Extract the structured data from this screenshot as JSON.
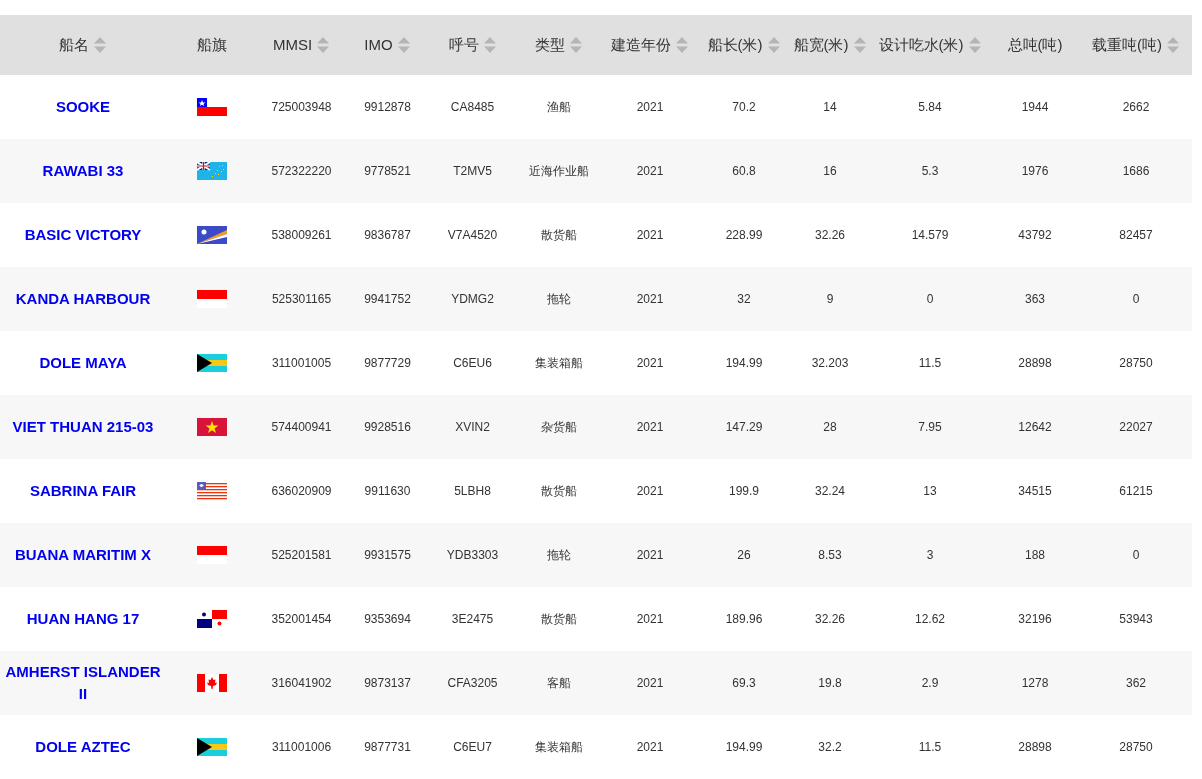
{
  "table": {
    "columns": [
      {
        "label": "船名",
        "sortable": true
      },
      {
        "label": "船旗",
        "sortable": false
      },
      {
        "label": "MMSI",
        "sortable": true
      },
      {
        "label": "IMO",
        "sortable": true
      },
      {
        "label": "呼号",
        "sortable": true
      },
      {
        "label": "类型",
        "sortable": true
      },
      {
        "label": "建造年份",
        "sortable": true
      },
      {
        "label": "船长(米)",
        "sortable": true
      },
      {
        "label": "船宽(米)",
        "sortable": true
      },
      {
        "label": "设计吃水(米)",
        "sortable": true
      },
      {
        "label": "总吨(吨)",
        "sortable": false
      },
      {
        "label": "载重吨(吨)",
        "sortable": true
      }
    ],
    "rows": [
      {
        "cells": [
          {
            "kind": "link",
            "text": "SOOKE"
          },
          {
            "kind": "chile"
          },
          {
            "kind": "text",
            "text": "725003948"
          },
          {
            "kind": "text",
            "text": "9912878"
          },
          {
            "kind": "text",
            "text": "CA8485"
          },
          {
            "kind": "text",
            "text": "渔船"
          },
          {
            "kind": "text",
            "text": "2021"
          },
          {
            "kind": "text",
            "text": "70.2"
          },
          {
            "kind": "text",
            "text": "14"
          },
          {
            "kind": "text",
            "text": "5.84"
          },
          {
            "kind": "text",
            "text": "1944"
          },
          {
            "kind": "text",
            "text": "2662"
          }
        ]
      },
      {
        "cells": [
          {
            "kind": "link",
            "text": "RAWABI 33"
          },
          {
            "kind": "tuvalu"
          },
          {
            "kind": "text",
            "text": "572322220"
          },
          {
            "kind": "text",
            "text": "9778521"
          },
          {
            "kind": "text",
            "text": "T2MV5"
          },
          {
            "kind": "text",
            "text": "近海作业船"
          },
          {
            "kind": "text",
            "text": "2021"
          },
          {
            "kind": "text",
            "text": "60.8"
          },
          {
            "kind": "text",
            "text": "16"
          },
          {
            "kind": "text",
            "text": "5.3"
          },
          {
            "kind": "text",
            "text": "1976"
          },
          {
            "kind": "text",
            "text": "1686"
          }
        ]
      },
      {
        "cells": [
          {
            "kind": "link",
            "text": "BASIC VICTORY"
          },
          {
            "kind": "marshall"
          },
          {
            "kind": "text",
            "text": "538009261"
          },
          {
            "kind": "text",
            "text": "9836787"
          },
          {
            "kind": "text",
            "text": "V7A4520"
          },
          {
            "kind": "text",
            "text": "散货船"
          },
          {
            "kind": "text",
            "text": "2021"
          },
          {
            "kind": "text",
            "text": "228.99"
          },
          {
            "kind": "text",
            "text": "32.26"
          },
          {
            "kind": "text",
            "text": "14.579"
          },
          {
            "kind": "text",
            "text": "43792"
          },
          {
            "kind": "text",
            "text": "82457"
          }
        ]
      },
      {
        "cells": [
          {
            "kind": "link",
            "text": "KANDA HARBOUR"
          },
          {
            "kind": "indonesia"
          },
          {
            "kind": "text",
            "text": "525301165"
          },
          {
            "kind": "text",
            "text": "9941752"
          },
          {
            "kind": "text",
            "text": "YDMG2"
          },
          {
            "kind": "text",
            "text": "拖轮"
          },
          {
            "kind": "text",
            "text": "2021"
          },
          {
            "kind": "text",
            "text": "32"
          },
          {
            "kind": "text",
            "text": "9"
          },
          {
            "kind": "text",
            "text": "0"
          },
          {
            "kind": "text",
            "text": "363"
          },
          {
            "kind": "text",
            "text": "0"
          }
        ]
      },
      {
        "cells": [
          {
            "kind": "link",
            "text": "DOLE MAYA"
          },
          {
            "kind": "bahamas"
          },
          {
            "kind": "text",
            "text": "311001005"
          },
          {
            "kind": "text",
            "text": "9877729"
          },
          {
            "kind": "text",
            "text": "C6EU6"
          },
          {
            "kind": "text",
            "text": "集装箱船"
          },
          {
            "kind": "text",
            "text": "2021"
          },
          {
            "kind": "text",
            "text": "194.99"
          },
          {
            "kind": "text",
            "text": "32.203"
          },
          {
            "kind": "text",
            "text": "11.5"
          },
          {
            "kind": "text",
            "text": "28898"
          },
          {
            "kind": "text",
            "text": "28750"
          }
        ]
      },
      {
        "cells": [
          {
            "kind": "link",
            "text": "VIET THUAN 215-03"
          },
          {
            "kind": "vietnam"
          },
          {
            "kind": "text",
            "text": "574400941"
          },
          {
            "kind": "text",
            "text": "9928516"
          },
          {
            "kind": "text",
            "text": "XVIN2"
          },
          {
            "kind": "text",
            "text": "杂货船"
          },
          {
            "kind": "text",
            "text": "2021"
          },
          {
            "kind": "text",
            "text": "147.29"
          },
          {
            "kind": "text",
            "text": "28"
          },
          {
            "kind": "text",
            "text": "7.95"
          },
          {
            "kind": "text",
            "text": "12642"
          },
          {
            "kind": "text",
            "text": "22027"
          }
        ]
      },
      {
        "cells": [
          {
            "kind": "link",
            "text": "SABRINA FAIR"
          },
          {
            "kind": "liberia"
          },
          {
            "kind": "text",
            "text": "636020909"
          },
          {
            "kind": "text",
            "text": "9911630"
          },
          {
            "kind": "text",
            "text": "5LBH8"
          },
          {
            "kind": "text",
            "text": "散货船"
          },
          {
            "kind": "text",
            "text": "2021"
          },
          {
            "kind": "text",
            "text": "199.9"
          },
          {
            "kind": "text",
            "text": "32.24"
          },
          {
            "kind": "text",
            "text": "13"
          },
          {
            "kind": "text",
            "text": "34515"
          },
          {
            "kind": "text",
            "text": "61215"
          }
        ]
      },
      {
        "cells": [
          {
            "kind": "link",
            "text": "BUANA MARITIM X"
          },
          {
            "kind": "indonesia"
          },
          {
            "kind": "text",
            "text": "525201581"
          },
          {
            "kind": "text",
            "text": "9931575"
          },
          {
            "kind": "text",
            "text": "YDB3303"
          },
          {
            "kind": "text",
            "text": "拖轮"
          },
          {
            "kind": "text",
            "text": "2021"
          },
          {
            "kind": "text",
            "text": "26"
          },
          {
            "kind": "text",
            "text": "8.53"
          },
          {
            "kind": "text",
            "text": "3"
          },
          {
            "kind": "text",
            "text": "188"
          },
          {
            "kind": "text",
            "text": "0"
          }
        ]
      },
      {
        "cells": [
          {
            "kind": "link",
            "text": "HUAN HANG 17"
          },
          {
            "kind": "panama"
          },
          {
            "kind": "text",
            "text": "352001454"
          },
          {
            "kind": "text",
            "text": "9353694"
          },
          {
            "kind": "text",
            "text": "3E2475"
          },
          {
            "kind": "text",
            "text": "散货船"
          },
          {
            "kind": "text",
            "text": "2021"
          },
          {
            "kind": "text",
            "text": "189.96"
          },
          {
            "kind": "text",
            "text": "32.26"
          },
          {
            "kind": "text",
            "text": "12.62"
          },
          {
            "kind": "text",
            "text": "32196"
          },
          {
            "kind": "text",
            "text": "53943"
          }
        ]
      },
      {
        "cells": [
          {
            "kind": "link",
            "text": "AMHERST ISLANDER II"
          },
          {
            "kind": "canada"
          },
          {
            "kind": "text",
            "text": "316041902"
          },
          {
            "kind": "text",
            "text": "9873137"
          },
          {
            "kind": "text",
            "text": "CFA3205"
          },
          {
            "kind": "text",
            "text": "客船"
          },
          {
            "kind": "text",
            "text": "2021"
          },
          {
            "kind": "text",
            "text": "69.3"
          },
          {
            "kind": "text",
            "text": "19.8"
          },
          {
            "kind": "text",
            "text": "2.9"
          },
          {
            "kind": "text",
            "text": "1278"
          },
          {
            "kind": "text",
            "text": "362"
          }
        ]
      },
      {
        "cells": [
          {
            "kind": "link",
            "text": "DOLE AZTEC"
          },
          {
            "kind": "bahamas"
          },
          {
            "kind": "text",
            "text": "311001006"
          },
          {
            "kind": "text",
            "text": "9877731"
          },
          {
            "kind": "text",
            "text": "C6EU7"
          },
          {
            "kind": "text",
            "text": "集装箱船"
          },
          {
            "kind": "text",
            "text": "2021"
          },
          {
            "kind": "text",
            "text": "194.99"
          },
          {
            "kind": "text",
            "text": "32.2"
          },
          {
            "kind": "text",
            "text": "11.5"
          },
          {
            "kind": "text",
            "text": "28898"
          },
          {
            "kind": "text",
            "text": "28750"
          }
        ]
      }
    ]
  }
}
